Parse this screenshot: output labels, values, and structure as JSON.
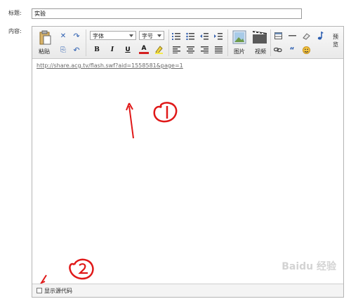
{
  "form": {
    "title_label": "标题:",
    "title_value": "实验",
    "content_label": "内容:"
  },
  "toolbar": {
    "paste_label": "粘贴",
    "font_family_value": "字体",
    "font_size_value": "字号",
    "image_label": "图片",
    "video_label": "视频",
    "preview_label": "预览",
    "bold": "B",
    "italic": "I",
    "underline": "U",
    "font_color": "A",
    "undo": "↶",
    "redo": "↷",
    "cut": "✕",
    "copy": "⎘"
  },
  "editor": {
    "content_link": "http://share.acg.tv/flash.swf?aid=1558581&page=1"
  },
  "footer": {
    "show_source_label": "显示源代码"
  },
  "annotations": {
    "mark_1": "①",
    "mark_2": "②"
  },
  "watermark": {
    "text": "Baidu 经验"
  },
  "colors": {
    "annotation_red": "#e01818",
    "link_gray": "#6a6a6a"
  }
}
